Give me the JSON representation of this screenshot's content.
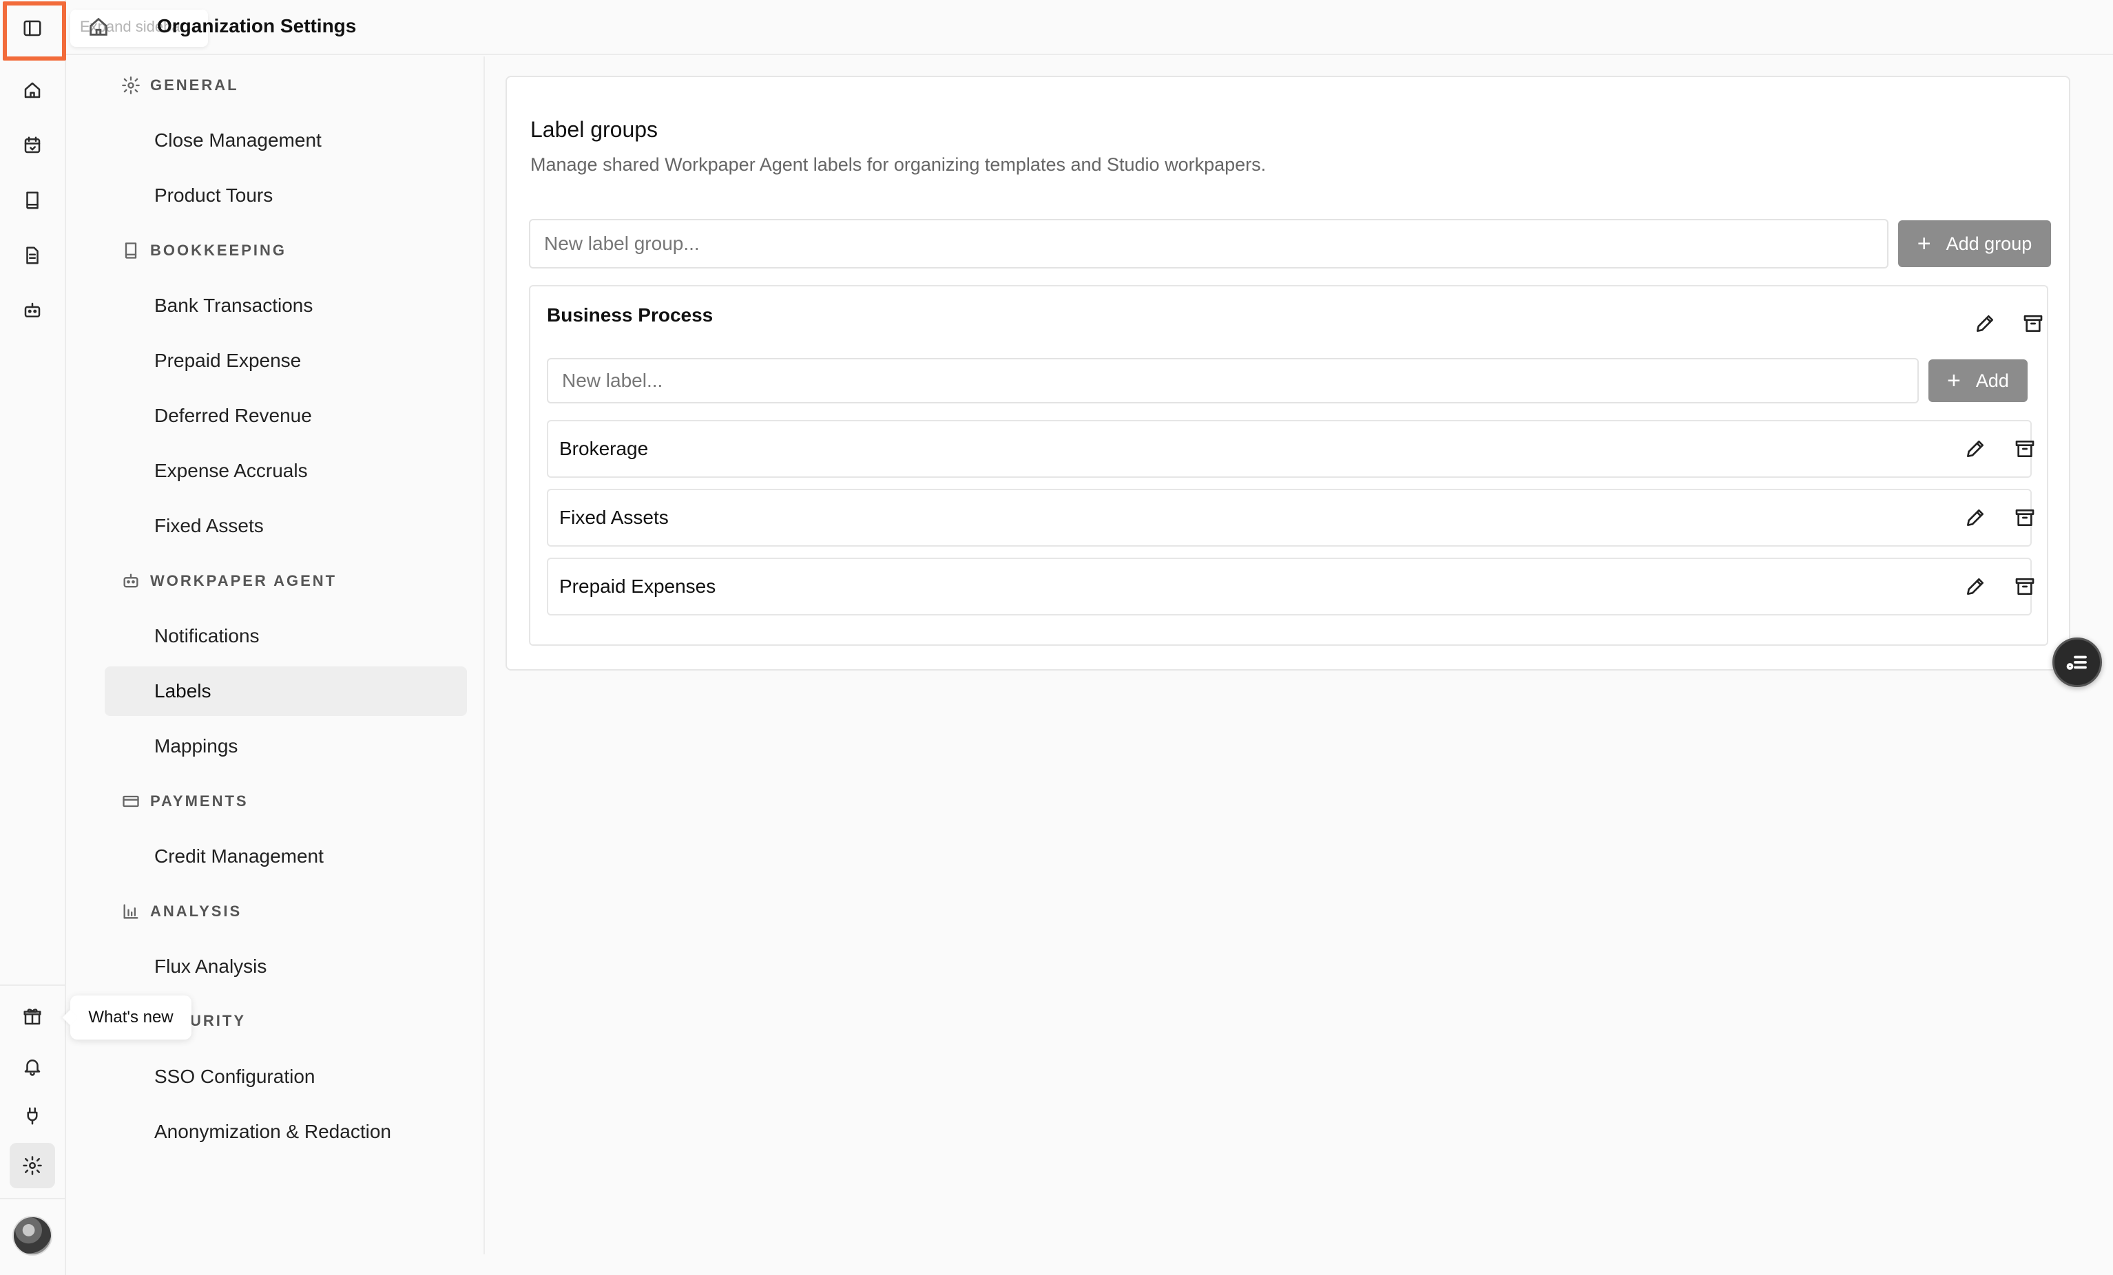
{
  "header": {
    "expand_tooltip": "Expand sidebar",
    "title": "Organization Settings"
  },
  "rail": {
    "icons": [
      "sidebar-toggle-icon",
      "home-icon",
      "calendar-check-icon",
      "book-icon",
      "document-icon",
      "bot-icon",
      "gift-icon",
      "bell-icon",
      "plug-icon",
      "gear-icon",
      "avatar"
    ],
    "tooltip": "What's new"
  },
  "settings_nav": {
    "sections": [
      {
        "label": "GENERAL",
        "icon": "gear-icon",
        "items": [
          "Close Management",
          "Product Tours"
        ]
      },
      {
        "label": "BOOKKEEPING",
        "icon": "book-icon",
        "items": [
          "Bank Transactions",
          "Prepaid Expense",
          "Deferred Revenue",
          "Expense Accruals",
          "Fixed Assets"
        ]
      },
      {
        "label": "WORKPAPER AGENT",
        "icon": "bot-icon",
        "items": [
          "Notifications",
          "Labels",
          "Mappings"
        ]
      },
      {
        "label": "PAYMENTS",
        "icon": "card-icon",
        "items": [
          "Credit Management"
        ]
      },
      {
        "label": "ANALYSIS",
        "icon": "bar-chart-icon",
        "items": [
          "Flux Analysis"
        ]
      },
      {
        "label": "SECURITY",
        "visible_label": "URITY",
        "icon": "shield-icon",
        "items": [
          "SSO Configuration",
          "Anonymization & Redaction"
        ]
      }
    ],
    "active_item": "Labels"
  },
  "main": {
    "title": "Label groups",
    "subtitle": "Manage shared Workpaper Agent labels for organizing templates and Studio workpapers.",
    "new_group_placeholder": "New label group...",
    "add_group_label": "Add group",
    "groups": [
      {
        "name": "Business Process",
        "new_label_placeholder": "New label...",
        "add_label": "Add",
        "labels": [
          "Brokerage",
          "Fixed Assets",
          "Prepaid Expenses"
        ]
      }
    ]
  },
  "colors": {
    "highlight": "#f26b3a",
    "button_gray": "#8c8c8c",
    "active_nav_bg": "#eeeeee"
  }
}
